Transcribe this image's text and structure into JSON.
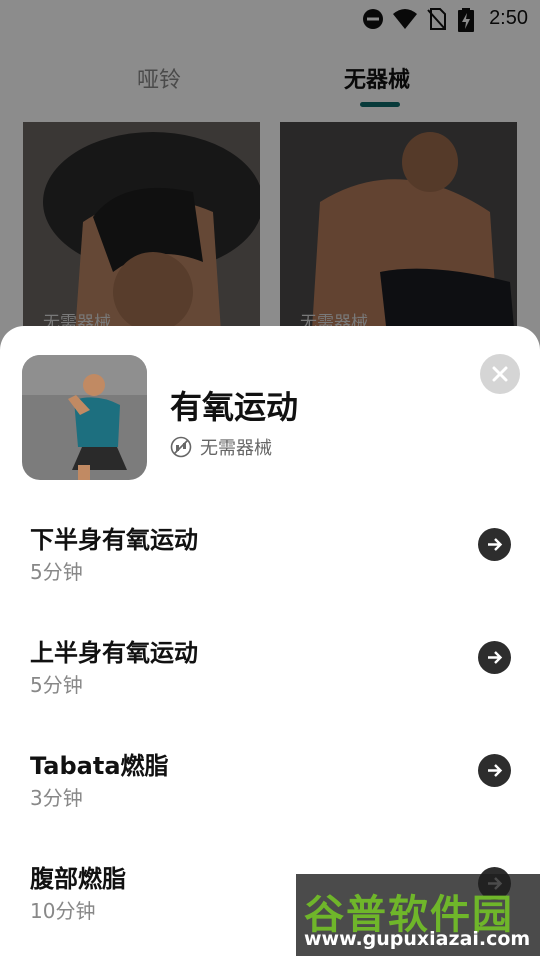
{
  "status_bar": {
    "time": "2:50"
  },
  "tabs": [
    {
      "label": "哑铃"
    },
    {
      "label": "无器械"
    }
  ],
  "cards": [
    {
      "tag": "无需器械"
    },
    {
      "tag": "无需器械"
    }
  ],
  "sheet": {
    "title": "有氧运动",
    "equipment": "无需器械",
    "items": [
      {
        "name": "下半身有氧运动",
        "duration": "5分钟"
      },
      {
        "name": "上半身有氧运动",
        "duration": "5分钟"
      },
      {
        "name": "Tabata燃脂",
        "duration": "3分钟"
      },
      {
        "name": "腹部燃脂",
        "duration": "10分钟"
      }
    ]
  },
  "watermark": {
    "name": "谷普软件园",
    "url": "www.gupuxiazai.com"
  },
  "colors": {
    "accent": "#0d6b6b",
    "arrow_bg": "#2d2d2d",
    "close_bg": "#d5d5d5"
  }
}
